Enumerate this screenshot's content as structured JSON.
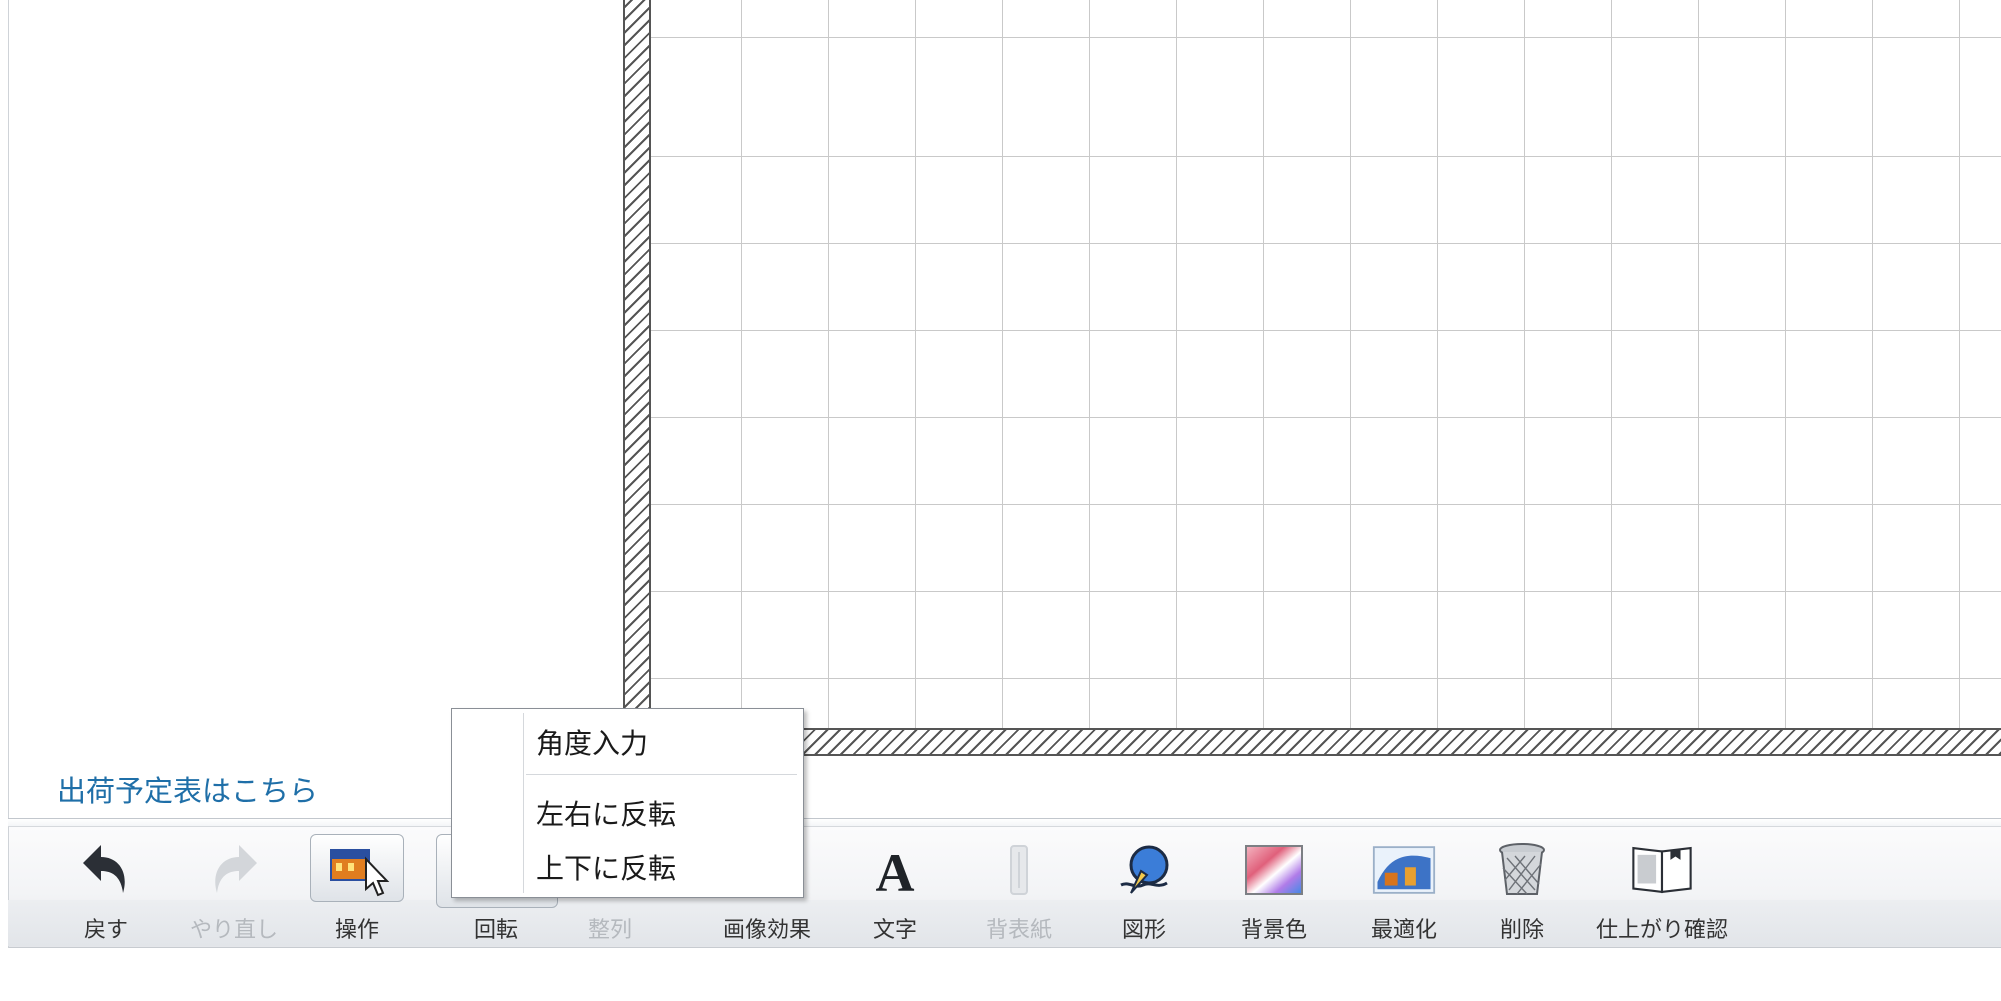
{
  "left_panel": {
    "shipping_link": "出荷予定表はこちら"
  },
  "popup_menu": {
    "items": [
      "角度入力",
      "左右に反転",
      "上下に反転"
    ]
  },
  "toolbar": {
    "items": [
      {
        "label": "戻す",
        "icon": "undo-icon",
        "enabled": true
      },
      {
        "label": "やり直し",
        "icon": "redo-icon",
        "enabled": false
      },
      {
        "label": "操作",
        "icon": "image-operate-icon",
        "enabled": true,
        "active": true
      },
      {
        "label": "回転",
        "icon": "rotate-icon",
        "enabled": true,
        "active": true
      },
      {
        "label": "整列",
        "icon": "align-icon",
        "enabled": false
      },
      {
        "label": "画像効果",
        "icon": "image-effect-icon",
        "enabled": true
      },
      {
        "label": "文字",
        "icon": "text-icon",
        "enabled": true
      },
      {
        "label": "背表紙",
        "icon": "spine-icon",
        "enabled": false
      },
      {
        "label": "図形",
        "icon": "shape-icon",
        "enabled": true
      },
      {
        "label": "背景色",
        "icon": "background-color-icon",
        "enabled": true
      },
      {
        "label": "最適化",
        "icon": "optimize-icon",
        "enabled": true
      },
      {
        "label": "削除",
        "icon": "trash-icon",
        "enabled": true
      },
      {
        "label": "仕上がり確認",
        "icon": "preview-book-icon",
        "enabled": true
      }
    ]
  },
  "colors": {
    "link": "#1f6fa8",
    "disabled_text": "#b5b9be",
    "grid_line": "#c9c9c9"
  }
}
